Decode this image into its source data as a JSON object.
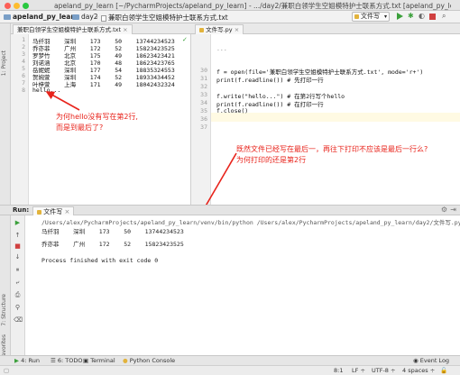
{
  "window": {
    "title": "apeland_py_learn [~/PycharmProjects/apeland_py_learn] - .../day2/兼职白领学生空姐模特护士联系方式.txt [apeland_py_learn]"
  },
  "nav": {
    "project": "apeland_py_learn",
    "folder": "day2",
    "file": "兼职白领学生空姐模特护士联系方式.txt",
    "run_config": "文件写"
  },
  "left_strip": {
    "project": "1: Project",
    "structure": "7: Structure",
    "favorites": "2: Favorites"
  },
  "left_editor": {
    "tab": "兼职白领学生空姐模特护士联系方式.txt",
    "line_numbers": [
      "1",
      "2",
      "3",
      "4",
      "5",
      "6",
      "7",
      "8"
    ],
    "lines": [
      "马纤羽    深圳    173    50    13744234523",
      "乔亦菲    广州    172    52    15823423525",
      "罗梦竹    北京    175    49    18623423421",
      "刘诺涵    北京    170    48    18623423765",
      "岳妮妮    深圳    177    54    18835324553",
      "贺婉萱    深圳    174    52    18933434452",
      "叶梓萱    上海    171    49    18042432324",
      "hello..."
    ]
  },
  "right_editor": {
    "tab": "文件写.py",
    "line_numbers": [
      "",
      "30",
      "31",
      "32",
      "33",
      "34",
      "35",
      "36",
      "37"
    ],
    "lines": [
      "...",
      "",
      "f = open(file='兼职白领学生空姐模特护士联系方式.txt', mode='r+')",
      "print(f.readline()) # 先打印一行",
      "",
      "f.write(\"hello...\") # 在第2行写个hello",
      "print(f.readline()) # 在打印一行",
      "f.close()",
      ""
    ]
  },
  "annotations": {
    "left_line1": "为何hello没有写在第2行,",
    "left_line2": "而是到最后了?",
    "right_line1": "既然文件已经写在最后一，再往下打印不应该是最后一行么?",
    "right_line2": "为何打印的还是第2行"
  },
  "run_panel": {
    "label": "Run:",
    "tab": "文件写",
    "console_lines": [
      "/Users/alex/PycharmProjects/apeland_py_learn/venv/bin/python /Users/alex/PycharmProjects/apeland_py_learn/day2/文件写.py",
      "马纤羽    深圳    173    50    13744234523",
      "",
      "乔亦菲    广州    172    52    15823423525",
      "",
      "Process finished with exit code 0"
    ]
  },
  "bottom_toolbar": {
    "run": "4: Run",
    "todo": "6: TODO",
    "terminal": "Terminal",
    "python_console": "Python Console",
    "event_log": "Event Log"
  },
  "status_bar": {
    "position": "8:1",
    "line_sep": "LF",
    "encoding": "UTF-8",
    "indent": "4 spaces"
  },
  "colors": {
    "annotation": "#e8231b",
    "run_green": "#3ba03b",
    "stop_red": "#d04040"
  }
}
